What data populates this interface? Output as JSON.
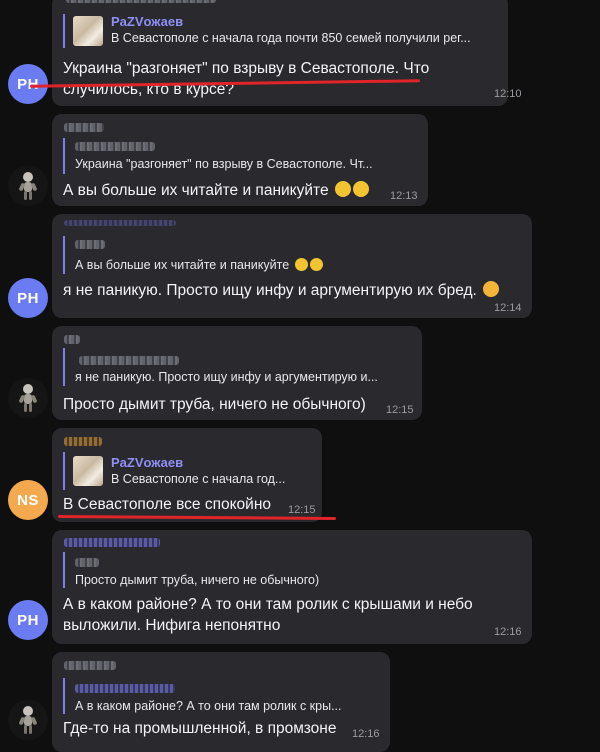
{
  "messages": [
    {
      "id": "m1",
      "avatar_initials": "PH",
      "reply_name": "PaZVожаев",
      "reply_text": "В Севастополе с начала года почти 850 семей получили рег...",
      "text_line1": "Украина \"разгоняет\" по взрыву в Севастополе. Что",
      "text_line2": "случилось, кто в курсе?",
      "time": "12:10"
    },
    {
      "id": "m2",
      "avatar_icon": "astronaut-avatar-icon",
      "reply_text": "Украина \"разгоняет\" по взрыву в Севастополе. Чт...",
      "text": "А вы больше их читайте и паникуйте",
      "time": "12:13"
    },
    {
      "id": "m3",
      "avatar_initials": "PH",
      "reply_text": "А вы больше их читайте и паникуйте",
      "text": "я не паникую. Просто ищу инфу и аргументирую их бред.",
      "time": "12:14"
    },
    {
      "id": "m4",
      "avatar_icon": "astronaut-avatar-icon",
      "reply_text": "я не паникую. Просто ищу инфу и аргументирую и...",
      "text": "Просто дымит труба, ничего не обычного)",
      "time": "12:15"
    },
    {
      "id": "m5",
      "avatar_initials": "NS",
      "reply_name": "PaZVожаев",
      "reply_text": "В Севастополе с начала год...",
      "text": "В Севастополе все спокойно",
      "time": "12:15"
    },
    {
      "id": "m6",
      "avatar_initials": "PH",
      "reply_text": "Просто дымит труба, ничего не обычного)",
      "text_line1": "А в каком районе? А то они там ролик с крышами и небо",
      "text_line2": "выложили. Нифига непонятно",
      "time": "12:16"
    },
    {
      "id": "m7",
      "avatar_icon": "astronaut-avatar-icon",
      "reply_text": "А в каком районе? А то они там ролик с кры...",
      "text": "Где-то на промышленной, в промзоне",
      "time": "12:16"
    }
  ],
  "colors": {
    "background": "#0f0f10",
    "bubble": "#2a2a2e",
    "accent": "#7d7ff0",
    "avatar_ph": "#6b7bf2",
    "avatar_ns": "#f5a94e",
    "annotation_red": "#e0242a"
  }
}
